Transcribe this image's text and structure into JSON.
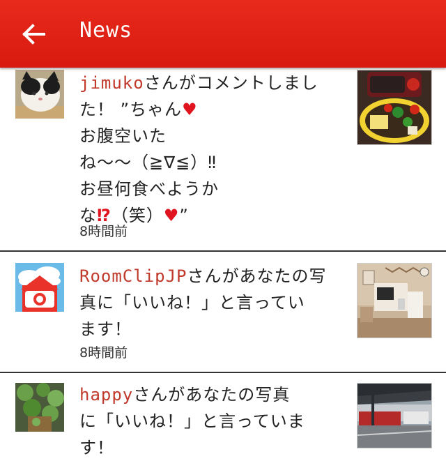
{
  "header": {
    "title": "News",
    "back_icon": "arrow-left-icon",
    "bg_color": "#e0231a"
  },
  "notifications": [
    {
      "user": "jimuko",
      "line1_rest": "さんがコメントしまし",
      "line2": "た！ ”ちゃん",
      "line3": "お腹空いた",
      "line4": "ね～～（≧∇≦）‼",
      "line5": "お昼何食べようか",
      "line6_a": "な",
      "line6_bang": "⁉",
      "line6_b": "（笑）",
      "line6_c": "”",
      "heart": "♥",
      "time": "8時間前"
    },
    {
      "user": "RoomClipJP",
      "line1_rest": "さんがあなたの写",
      "line2": "真に「いいね！」と言ってい",
      "line3": "ます！",
      "time": "8時間前"
    },
    {
      "user": "happy",
      "line1_rest": "さんがあなたの写真",
      "line2": "に「いいね！」と言っていま",
      "line3": "す！"
    }
  ]
}
